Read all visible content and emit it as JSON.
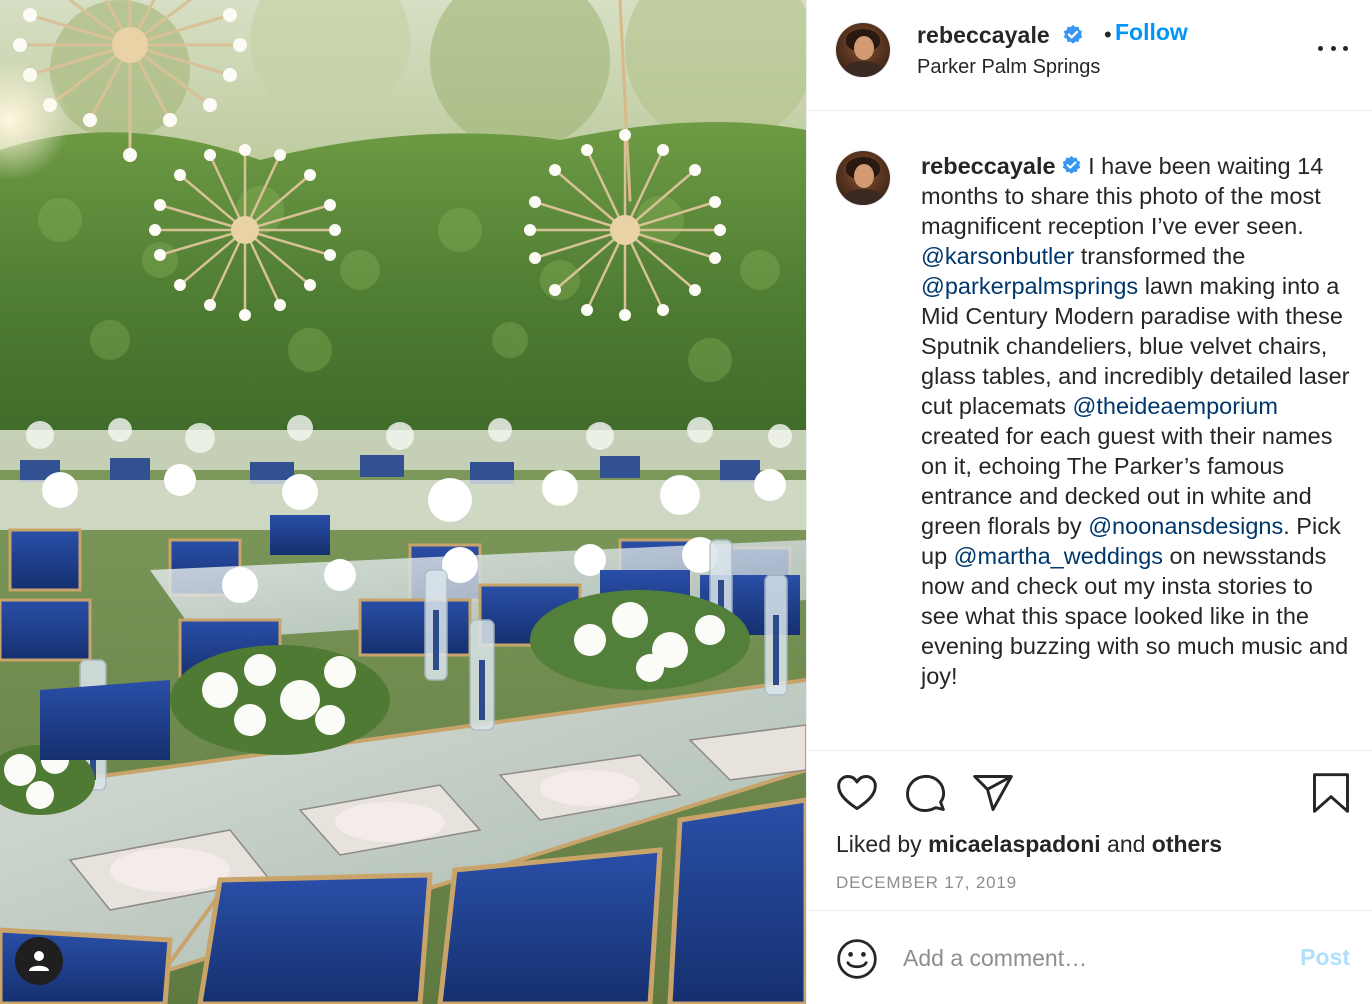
{
  "post": {
    "author": {
      "username": "rebeccayale",
      "verified": true,
      "location": "Parker Palm Springs",
      "follow_label": "Follow",
      "separator": "•"
    },
    "photo": {
      "subject_icons": [
        "sputnik-chandelier",
        "blue-velvet-chairs",
        "glass-tables",
        "white-floral-centerpieces"
      ],
      "user_tag_icon": "person-icon"
    },
    "caption": {
      "username": "rebeccayale",
      "segments": [
        {
          "type": "text",
          "text": " I have been waiting 14 months to share this photo of the most magnificent reception I’ve ever seen. "
        },
        {
          "type": "mention",
          "text": "@karsonbutler"
        },
        {
          "type": "text",
          "text": " transformed the "
        },
        {
          "type": "mention",
          "text": "@parkerpalmsprings"
        },
        {
          "type": "text",
          "text": " lawn making into a Mid Century Modern paradise with these Sputnik chandeliers, blue velvet chairs, glass tables, and incredibly detailed laser cut placemats "
        },
        {
          "type": "mention",
          "text": "@theideaemporium"
        },
        {
          "type": "text",
          "text": " created for each guest with their names on it, echoing The Parker’s famous entrance and decked out in white and green florals by "
        },
        {
          "type": "mention",
          "text": "@noonansdesigns"
        },
        {
          "type": "text",
          "text": ". Pick up "
        },
        {
          "type": "mention",
          "text": "@martha_weddings"
        },
        {
          "type": "text",
          "text": " on newsstands now and check out my insta stories to see what this space looked like in the evening buzzing with so much music and joy!"
        }
      ]
    },
    "actions": {
      "icons": [
        "heart-icon",
        "comment-icon",
        "share-icon",
        "bookmark-icon"
      ]
    },
    "likes": {
      "prefix": "Liked by ",
      "user": "micaelaspadoni",
      "middle": " and ",
      "others": "others"
    },
    "date": "DECEMBER 17, 2019",
    "comment": {
      "placeholder": "Add a comment…",
      "post_label": "Post",
      "emoji_icon": "smiley-icon"
    },
    "colors": {
      "link_blue": "#0095f6",
      "mention": "#00376b",
      "muted": "#8e8e8e",
      "post_disabled": "#b2dffc",
      "chair_blue": "#1f3f8f"
    }
  }
}
